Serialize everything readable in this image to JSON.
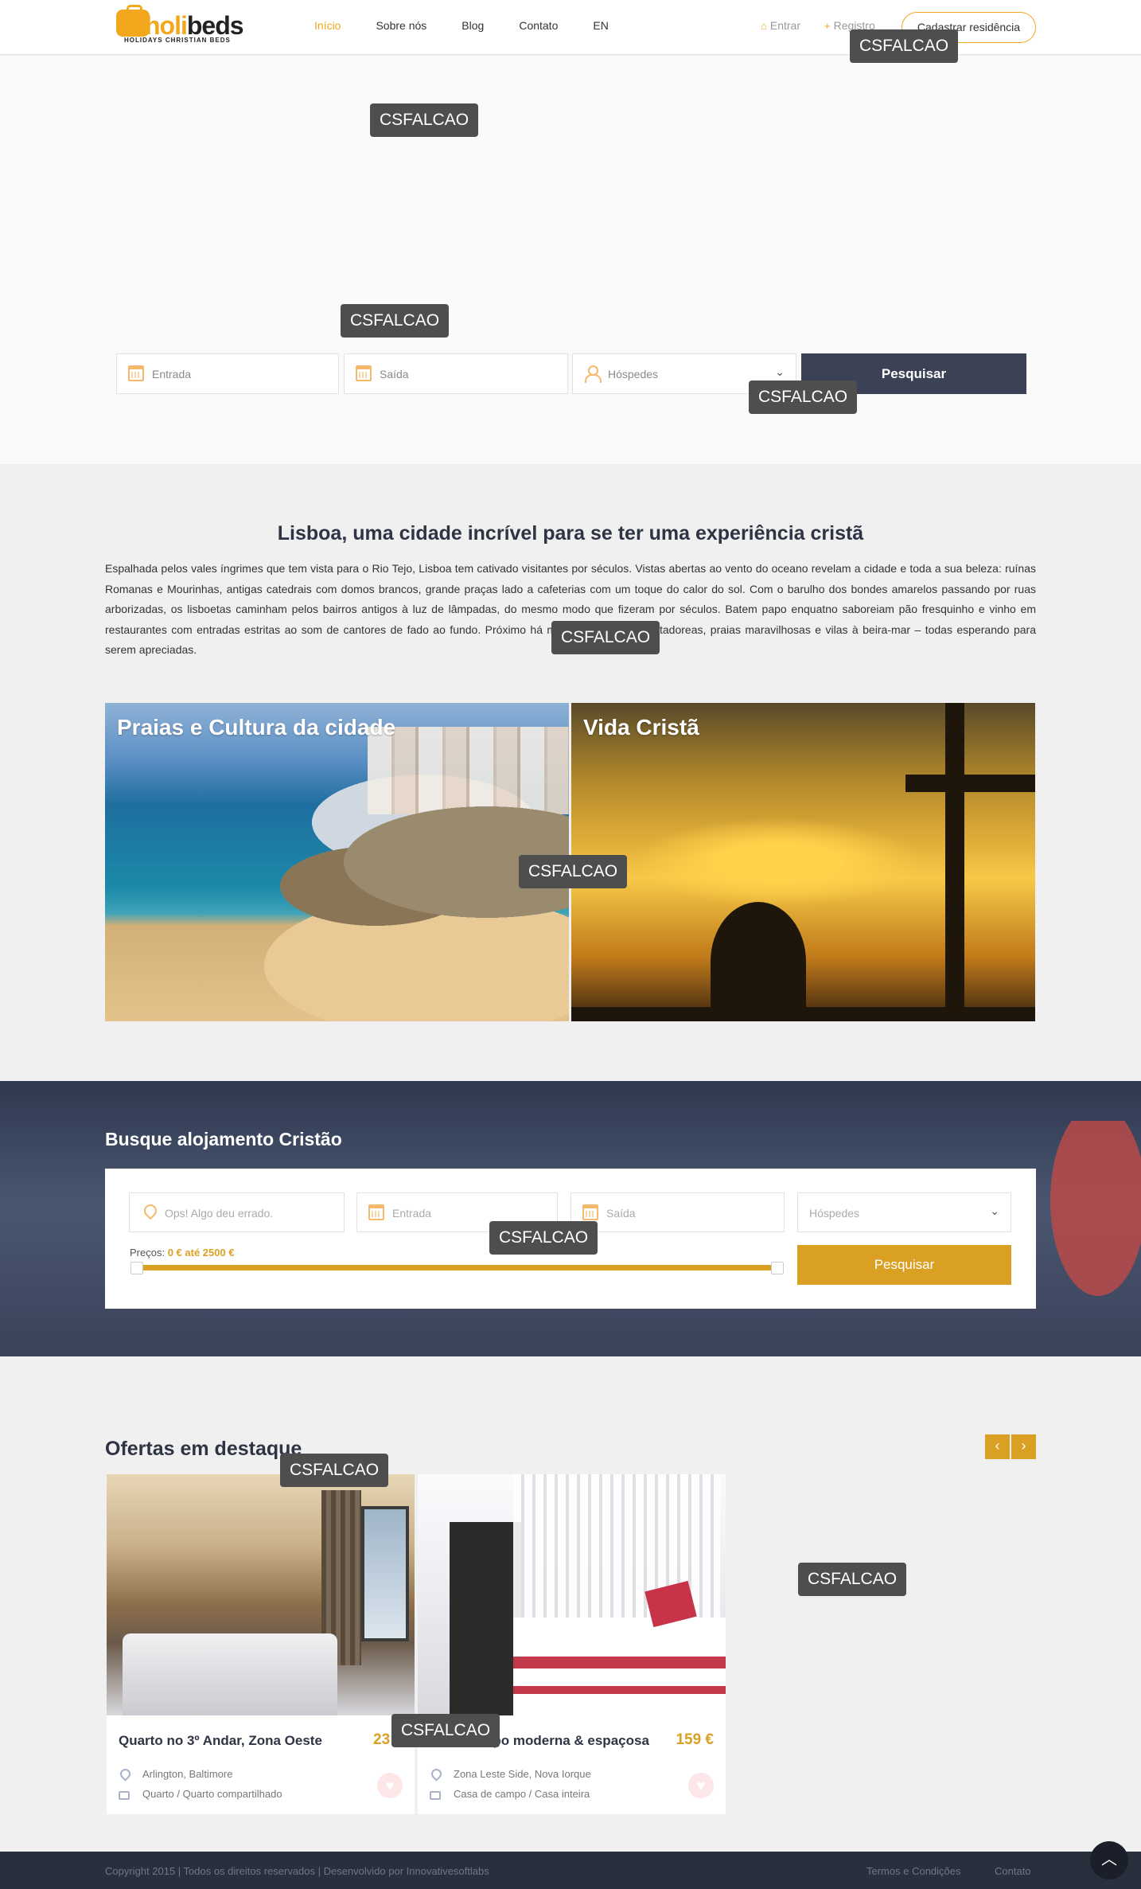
{
  "header": {
    "logo_text_a": "holi",
    "logo_text_b": "beds",
    "logo_tagline": "HOLIDAYS CHRISTIAN BEDS",
    "nav": [
      "Início",
      "Sobre nós",
      "Blog",
      "Contato",
      "EN"
    ],
    "login_label": "Entrar",
    "register_label": "Registro",
    "register_residence_label": "Cadastrar residência"
  },
  "watermark": "CSFALCAO",
  "hero_search": {
    "checkin_placeholder": "Entrada",
    "checkout_placeholder": "Saída",
    "guests_placeholder": "Hóspedes",
    "search_label": "Pesquisar"
  },
  "intro": {
    "title": "Lisboa, uma cidade incrível para se ter uma experiência cristã",
    "text": "Espalhada pelos vales íngrimes que tem vista para o Rio Tejo, Lisboa tem cativado visitantes por séculos. Vistas abertas ao vento do oceano revelam a cidade e toda a sua beleza: ruínas Romanas e Mourinhas, antigas catedrais com domos brancos, grande praças lado a cafeterias com um toque do calor do sol. Com o barulho dos bondes amarelos passando por ruas arborizadas, os lisboetas caminham pelos bairros antigos à luz de lâmpadas, do mesmo modo que fizeram por séculos. Batem papo enquatno saboreiam pão fresquinho e vinho em restaurantes com entradas estritas ao som de cantores de fado ao fundo. Próximo                          há mais - florestas encantadoreas, praias maravilhosas e vilas à beira-mar – todas esperando para serem apreciadas."
  },
  "tiles": [
    {
      "title": "Praias e Cultura da cidade"
    },
    {
      "title": "Vida Cristã"
    }
  ],
  "search_band": {
    "title": "Busque alojamento Cristão",
    "location_placeholder": "Ops! Algo deu errado.",
    "checkin_placeholder": "Entrada",
    "checkout_placeholder": "Saída",
    "guests_placeholder": "Hóspedes",
    "price_label": "Preços:",
    "price_range": "0 € até 2500 €",
    "price_min": 0,
    "price_max": 2500,
    "search_label": "Pesquisar"
  },
  "offers": {
    "title": "Ofertas em destaque",
    "prev": "‹",
    "next": "›",
    "items": [
      {
        "name": "Quarto no 3º Andar, Zona Oeste",
        "price": "23 €",
        "location": "Arlington, Baltimore",
        "type": "Quarto / Quarto compartilhado"
      },
      {
        "name": "Casa campo moderna & espaçosa",
        "price": "159 €",
        "location": "Zona Leste Side, Nova Iorque",
        "type": "Casa de campo / Casa inteira"
      }
    ]
  },
  "footer": {
    "copyright": "Copyright 2015 | Todos os direitos reservados | Desenvolvido por Innovativesoftlabs",
    "terms": "Termos e Condições",
    "contact": "Contato"
  },
  "colors": {
    "accent": "#f2a71d",
    "gold": "#d9a024",
    "dark": "#3b4256",
    "footer": "#2a2f3e"
  },
  "icons": [
    "calendar-icon",
    "user-icon",
    "chevron-down-icon",
    "home-icon",
    "plus-icon",
    "location-pin-icon",
    "folder-icon",
    "heart-icon",
    "arrow-up-icon",
    "info-icon"
  ]
}
